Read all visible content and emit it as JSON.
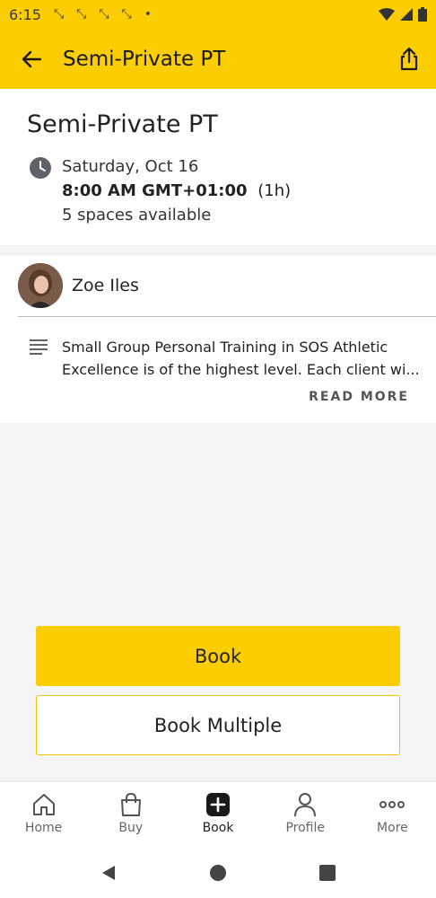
{
  "status_bar": {
    "time": "6:15"
  },
  "app_bar": {
    "title": "Semi-Private PT"
  },
  "class_info": {
    "title": "Semi-Private PT",
    "date": "Saturday, Oct 16",
    "time_bold": "8:00 AM GMT+01:00",
    "duration": "(1h)",
    "spaces": "5 spaces available"
  },
  "instructor": {
    "name": "Zoe Iles"
  },
  "description": {
    "text": "Small Group Personal Training in SOS Athletic Excellence is of the highest level. Each client wi...",
    "read_more": "READ MORE"
  },
  "actions": {
    "book": "Book",
    "book_multiple": "Book Multiple"
  },
  "bottom_nav": {
    "items": [
      {
        "label": "Home",
        "icon": "home-icon"
      },
      {
        "label": "Buy",
        "icon": "bag-icon"
      },
      {
        "label": "Book",
        "icon": "plus-icon"
      },
      {
        "label": "Profile",
        "icon": "person-icon"
      },
      {
        "label": "More",
        "icon": "more-icon"
      }
    ],
    "active": "Book"
  },
  "colors": {
    "accent": "#fccd00",
    "background": "#f5f5f8"
  }
}
